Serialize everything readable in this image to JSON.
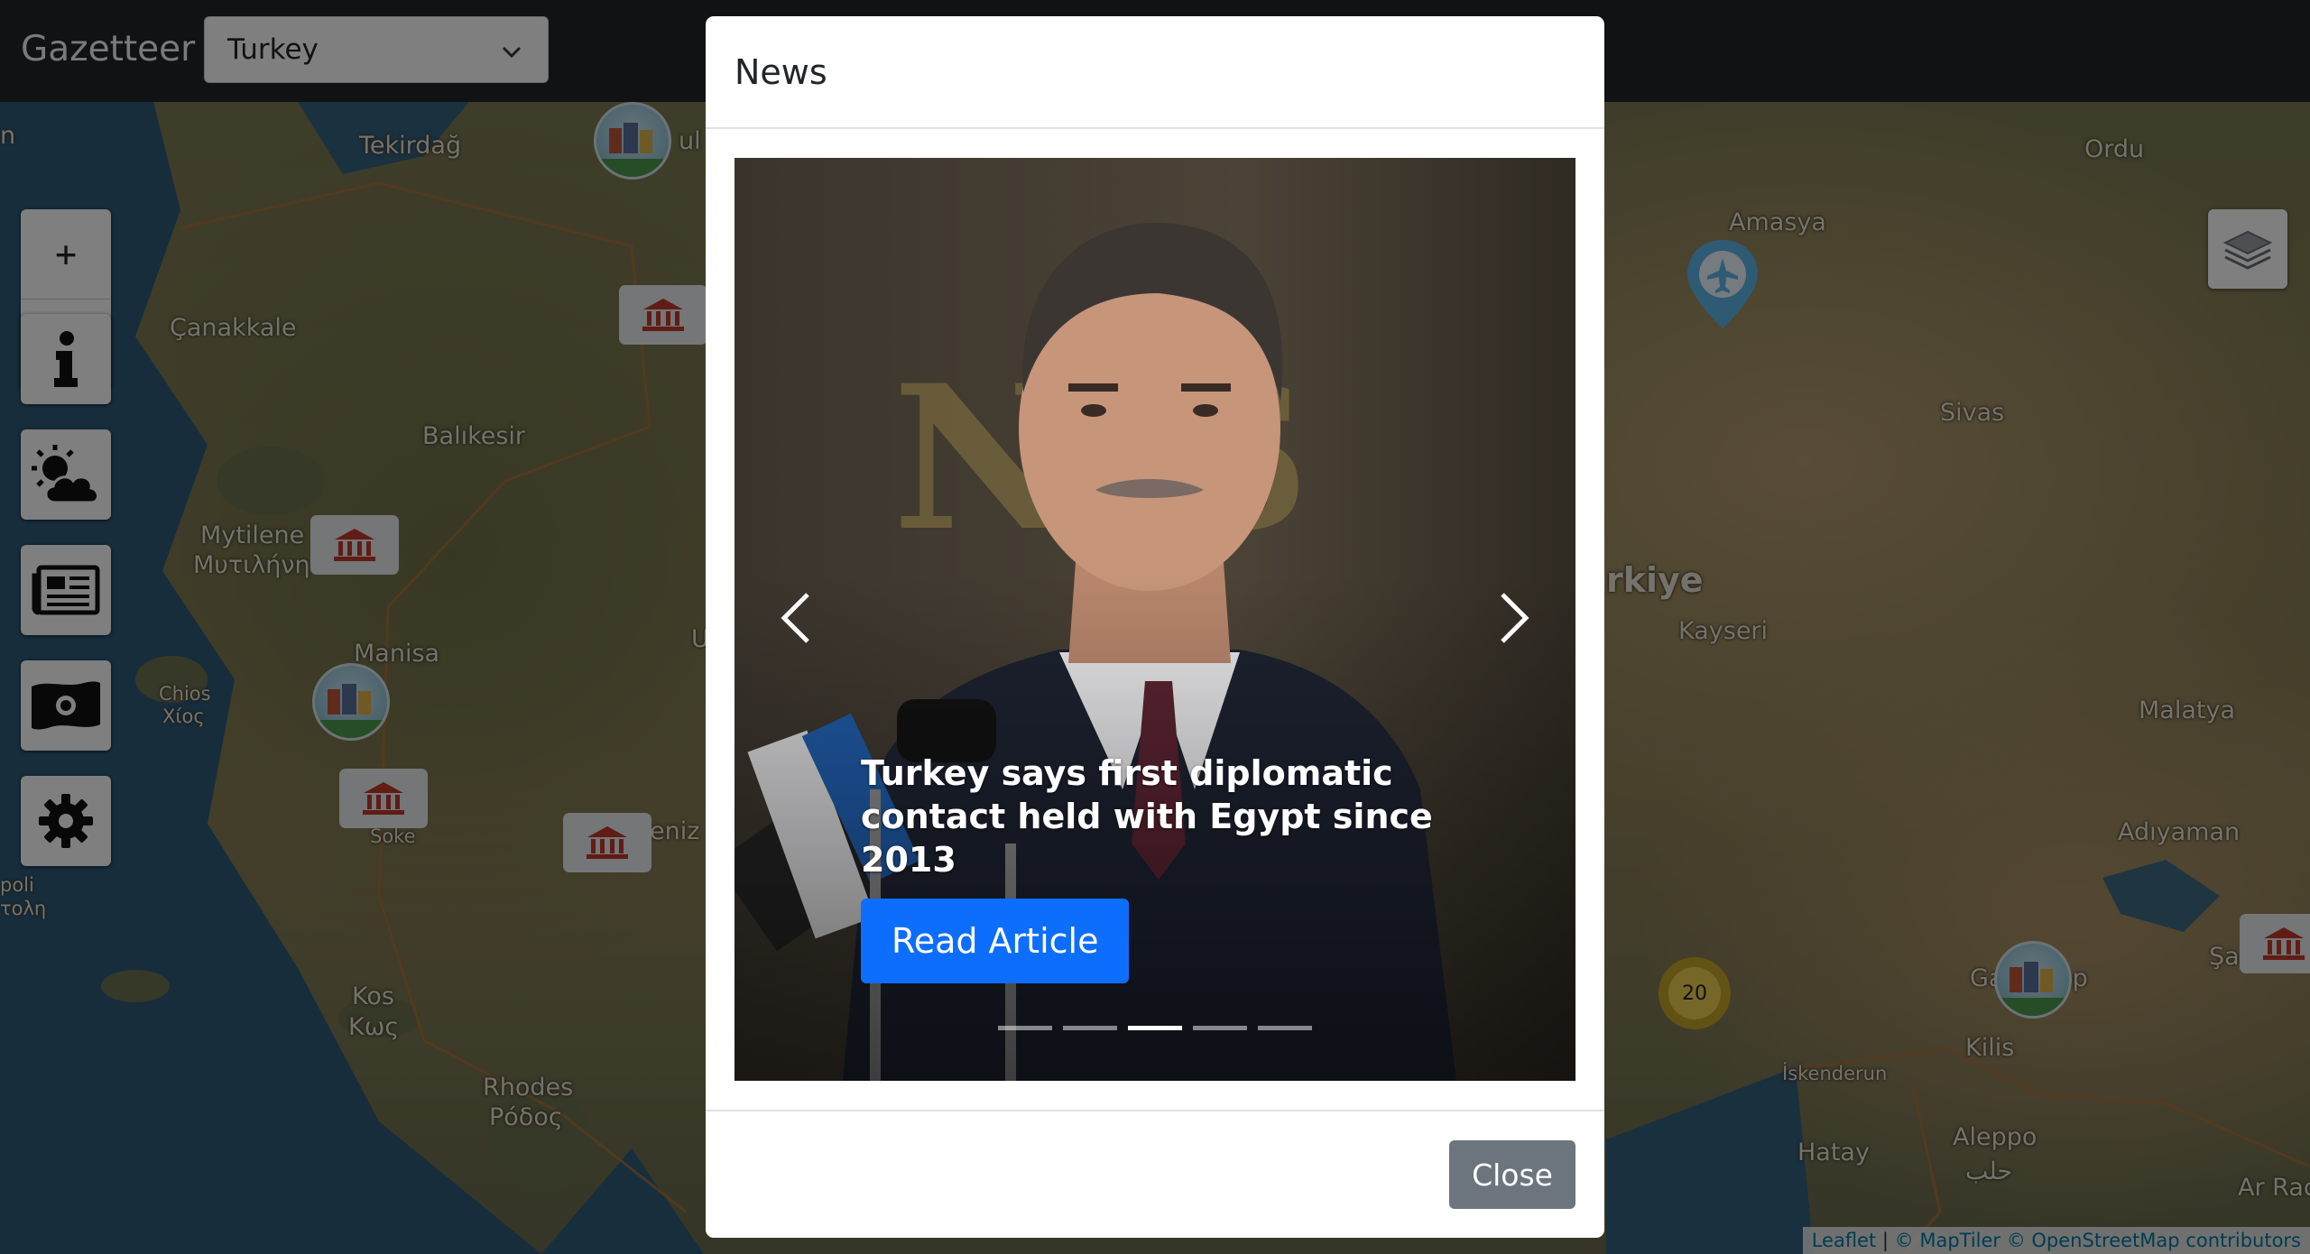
{
  "navbar": {
    "brand": "Gazetteer",
    "country_select": {
      "value": "Turkey"
    }
  },
  "map": {
    "places": [
      {
        "name": "Tekirdağ"
      },
      {
        "name": "Çanakkale"
      },
      {
        "name": "Balıkesir"
      },
      {
        "name": "Mytilene"
      },
      {
        "name": "Μυτιλήνη"
      },
      {
        "name": "Manisa"
      },
      {
        "name": "Chios"
      },
      {
        "name": "Χίος"
      },
      {
        "name": "Soke"
      },
      {
        "name": "poli"
      },
      {
        "name": "τολη"
      },
      {
        "name": "Kos"
      },
      {
        "name": "Κως"
      },
      {
        "name": "Rhodes"
      },
      {
        "name": "Ρόδος"
      },
      {
        "name": "Ordu"
      },
      {
        "name": "Amasya"
      },
      {
        "name": "Sivas"
      },
      {
        "name": "rkiye"
      },
      {
        "name": "Kayseri"
      },
      {
        "name": "Malatya"
      },
      {
        "name": "Adıyaman"
      },
      {
        "name": "Ga"
      },
      {
        "name": "ep"
      },
      {
        "name": "Şa"
      },
      {
        "name": "Kilis"
      },
      {
        "name": "İskenderun"
      },
      {
        "name": "Hatay"
      },
      {
        "name": "Aleppo"
      },
      {
        "name": "حلب"
      },
      {
        "name": "Ar Rac"
      },
      {
        "name": "U"
      },
      {
        "name": "n"
      },
      {
        "name": "eniz"
      },
      {
        "name": "ul"
      }
    ],
    "cluster_count": "20",
    "zoom_in": "+",
    "zoom_out": "−",
    "attribution": {
      "leaflet": "Leaflet",
      "sep": " | ",
      "rest": "© MapTiler © OpenStreetMap contributors"
    }
  },
  "modal": {
    "title": "News",
    "slides_total": 5,
    "active_slide": 3,
    "caption_title": "Turkey says first diplomatic contact held with Egypt since 2013",
    "read_button": "Read Article",
    "close_button": "Close"
  },
  "colors": {
    "navbar_bg": "#212529",
    "primary": "#0d6efd",
    "secondary": "#6c757d"
  }
}
